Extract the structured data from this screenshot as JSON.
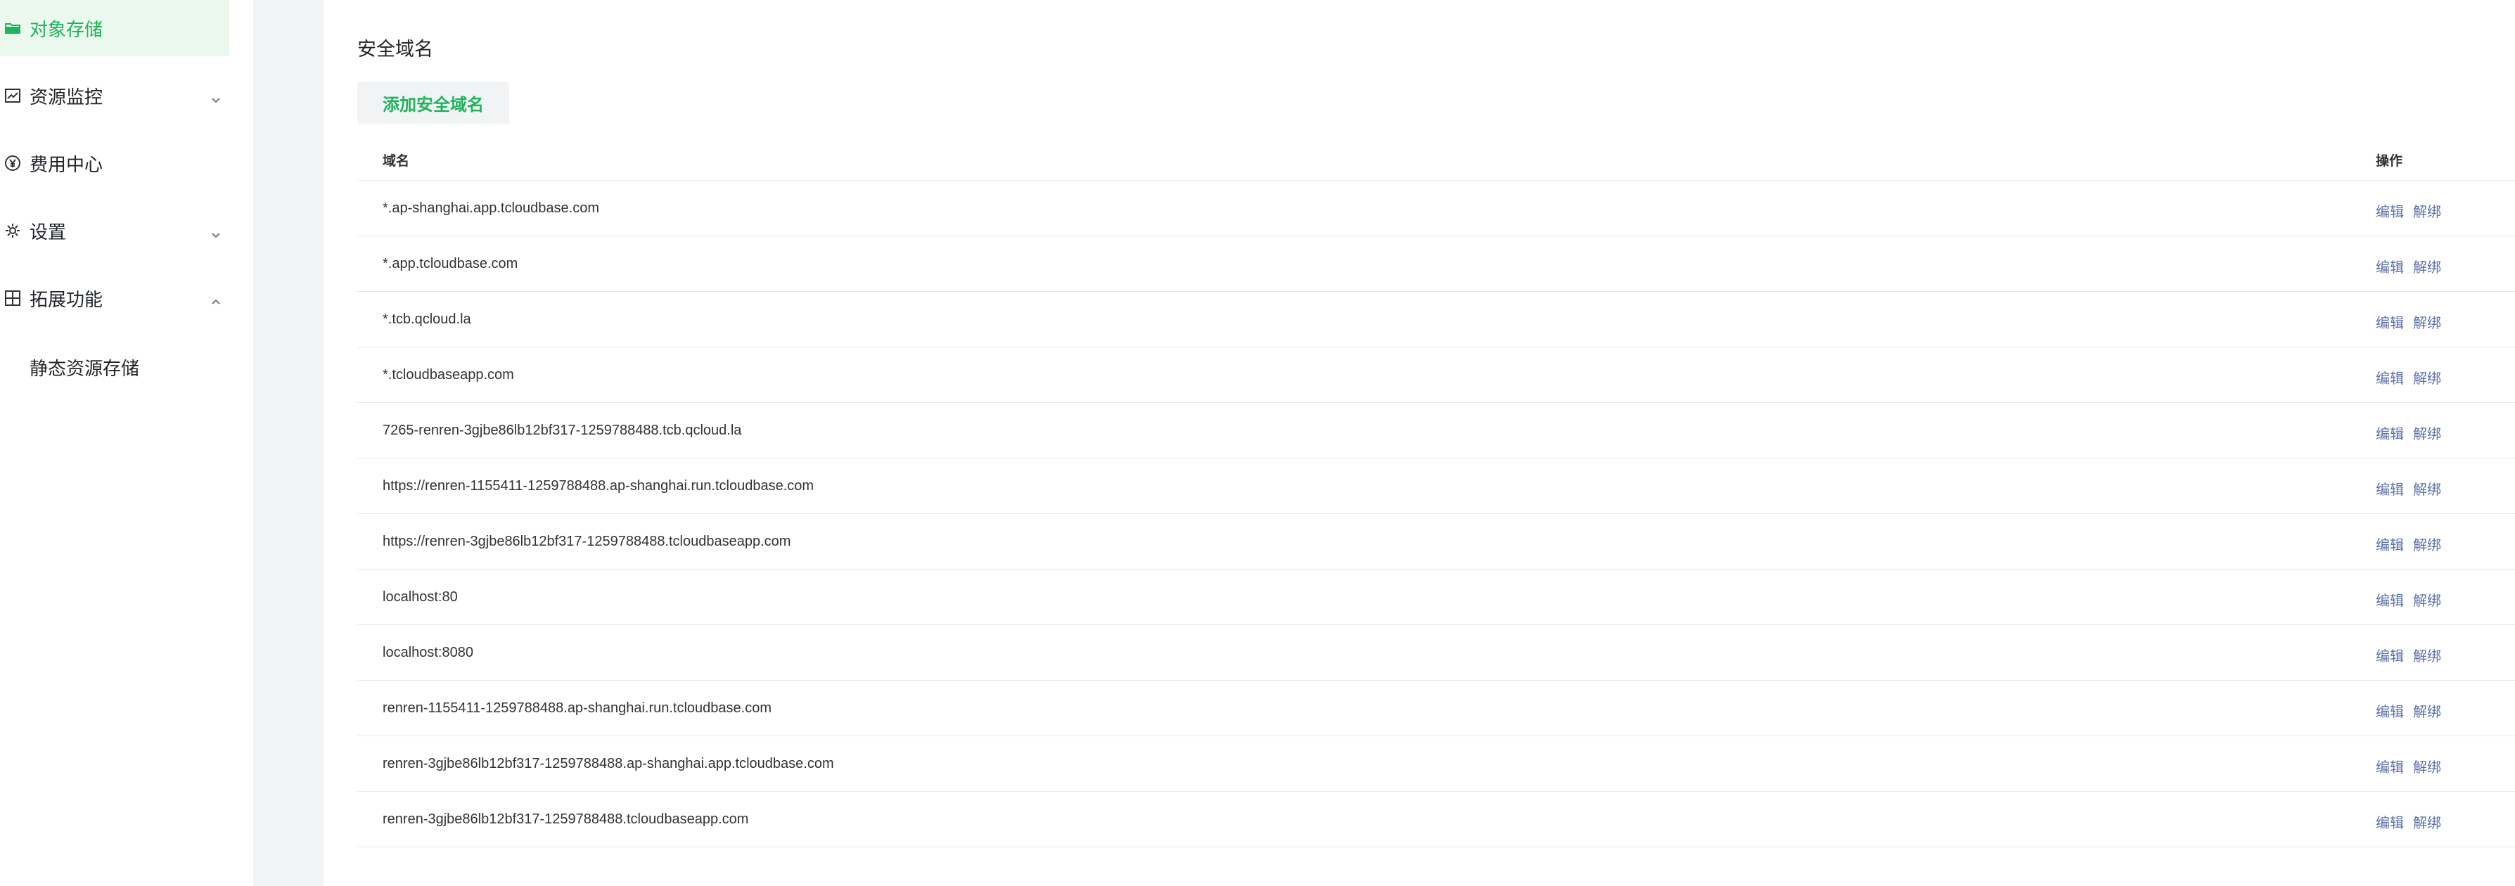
{
  "sidebar": {
    "items": [
      {
        "label": "对象存储",
        "icon": "folder-icon",
        "active": true
      },
      {
        "label": "资源监控",
        "icon": "chart-line-icon",
        "expandable": true,
        "expanded": false
      },
      {
        "label": "费用中心",
        "icon": "yen-circle-icon"
      },
      {
        "label": "设置",
        "icon": "gear-icon",
        "expandable": true,
        "expanded": false
      },
      {
        "label": "拓展功能",
        "icon": "grid-icon",
        "expandable": true,
        "expanded": true
      }
    ],
    "subitems": [
      {
        "label": "静态资源存储"
      }
    ]
  },
  "main": {
    "title": "安全域名",
    "add_button": "添加安全域名",
    "table": {
      "headers": {
        "domain": "域名",
        "actions": "操作"
      },
      "rows": [
        {
          "domain": "*.ap-shanghai.app.tcloudbase.com"
        },
        {
          "domain": "*.app.tcloudbase.com"
        },
        {
          "domain": "*.tcb.qcloud.la"
        },
        {
          "domain": "*.tcloudbaseapp.com"
        },
        {
          "domain": "7265-renren-3gjbe86lb12bf317-1259788488.tcb.qcloud.la"
        },
        {
          "domain": "https://renren-1155411-1259788488.ap-shanghai.run.tcloudbase.com"
        },
        {
          "domain": "https://renren-3gjbe86lb12bf317-1259788488.tcloudbaseapp.com"
        },
        {
          "domain": "localhost:80"
        },
        {
          "domain": "localhost:8080"
        },
        {
          "domain": "renren-1155411-1259788488.ap-shanghai.run.tcloudbase.com"
        },
        {
          "domain": "renren-3gjbe86lb12bf317-1259788488.ap-shanghai.app.tcloudbase.com"
        },
        {
          "domain": "renren-3gjbe86lb12bf317-1259788488.tcloudbaseapp.com"
        }
      ],
      "row_actions": {
        "edit": "编辑",
        "unbind": "解绑"
      }
    }
  },
  "colors": {
    "accent": "#1fb35c",
    "active_bg": "#eaf8ee",
    "link": "#5b70a8",
    "gutter": "#f3f4f6",
    "button_bg": "#f2f3f5"
  }
}
